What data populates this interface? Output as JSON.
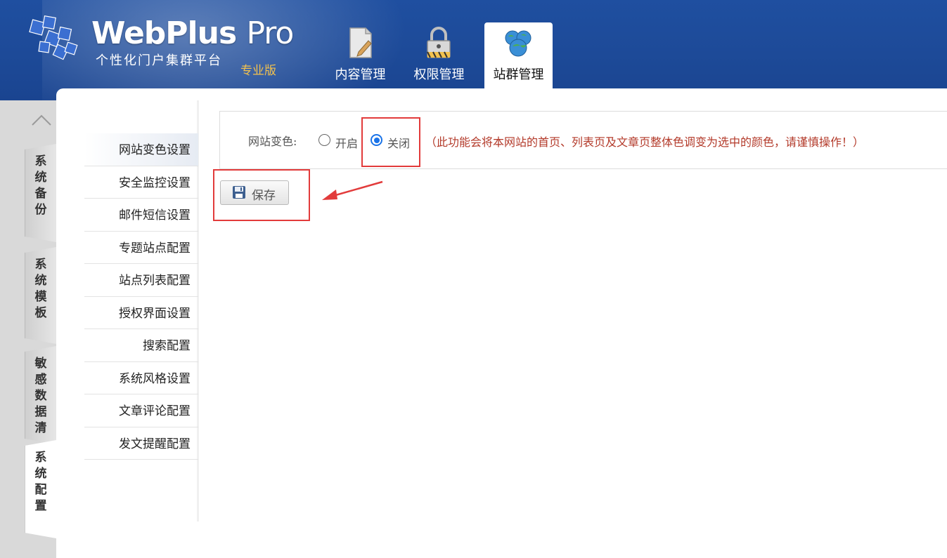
{
  "header": {
    "logo_title": "WebPlus",
    "logo_title_pro": "Pro",
    "logo_subtitle": "个性化门户集群平台",
    "edition": "专业版",
    "tabs": [
      {
        "label": "内容管理",
        "icon": "document-edit-icon",
        "active": false
      },
      {
        "label": "权限管理",
        "icon": "lock-icon",
        "active": false
      },
      {
        "label": "站群管理",
        "icon": "globe-cluster-icon",
        "active": true
      }
    ]
  },
  "left_tabs": [
    {
      "label": "系统备份",
      "active": false
    },
    {
      "label": "系统模板",
      "active": false
    },
    {
      "label": "敏感数据清",
      "active": false
    },
    {
      "label": "系统配置",
      "active": true
    }
  ],
  "submenu": {
    "items": [
      {
        "label": "网站变色设置",
        "active": true
      },
      {
        "label": "安全监控设置",
        "active": false
      },
      {
        "label": "邮件短信设置",
        "active": false
      },
      {
        "label": "专题站点配置",
        "active": false
      },
      {
        "label": "站点列表配置",
        "active": false
      },
      {
        "label": "授权界面设置",
        "active": false
      },
      {
        "label": "搜索配置",
        "active": false
      },
      {
        "label": "系统风格设置",
        "active": false
      },
      {
        "label": "文章评论配置",
        "active": false
      },
      {
        "label": "发文提醒配置",
        "active": false
      }
    ]
  },
  "form": {
    "label": "网站变色:",
    "options": [
      {
        "label": "开启",
        "checked": false
      },
      {
        "label": "关闭",
        "checked": true
      }
    ],
    "notice": "（此功能会将本网站的首页、列表页及文章页整体色调变为选中的颜色，请谨慎操作！）"
  },
  "save_button": {
    "label": "保存",
    "icon": "floppy-disk-icon"
  },
  "colors": {
    "header_blue": "#1d4a98",
    "highlight_red": "#e23b3b",
    "notice_red": "#b33a2a",
    "radio_blue": "#1a73e8",
    "edition_gold": "#f2c14e"
  }
}
